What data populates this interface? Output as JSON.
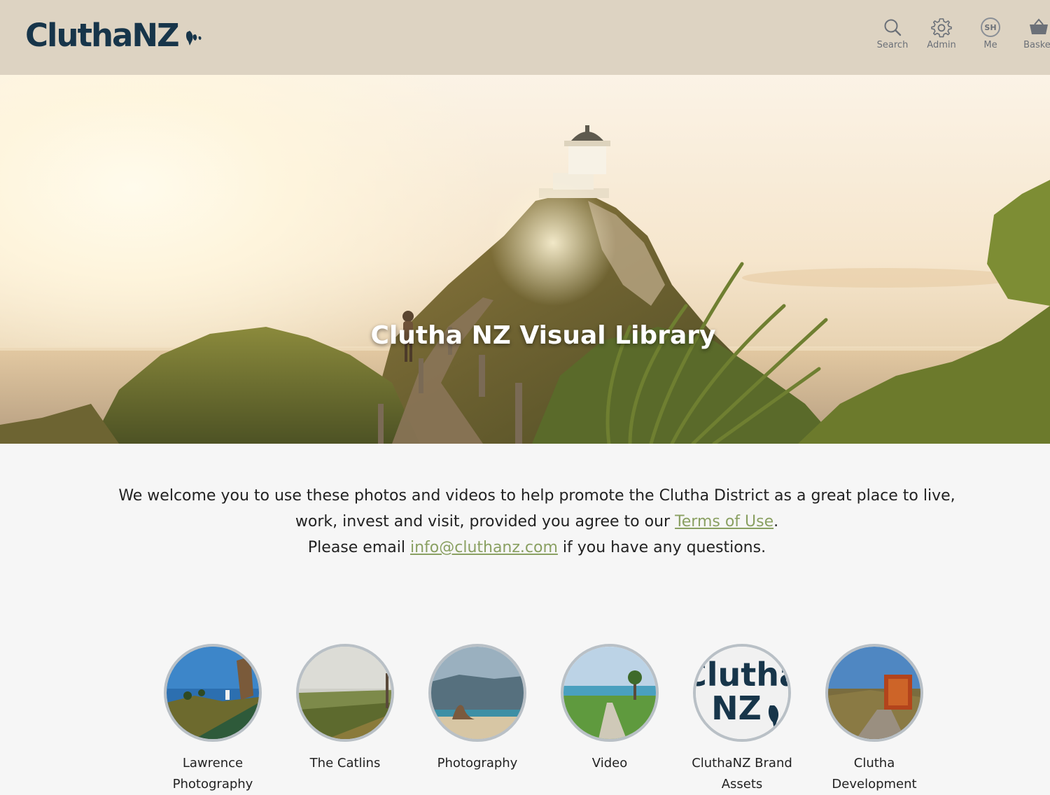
{
  "header": {
    "logo_text": "CluthaNZ",
    "nav": [
      {
        "label": "Search",
        "icon": "search-icon"
      },
      {
        "label": "Admin",
        "icon": "gear-icon"
      },
      {
        "label": "Me",
        "icon": "avatar-icon",
        "initials": "SH"
      },
      {
        "label": "Basket",
        "icon": "basket-icon"
      }
    ]
  },
  "hero": {
    "title": "Clutha NZ Visual Library"
  },
  "intro": {
    "line1": "We welcome you to use these photos and videos to help promote the Clutha District as a great place to live, work, invest and visit, provided you agree to our ",
    "terms_link": "Terms of Use",
    "line1_end": ".",
    "line2_start": "Please email ",
    "email_link": "info@cluthanz.com",
    "line2_end": " if you have any questions."
  },
  "collections": [
    {
      "label": "Lawrence Photography"
    },
    {
      "label": "The Catlins"
    },
    {
      "label": "Photography"
    },
    {
      "label": "Video"
    },
    {
      "label": "CluthaNZ Brand Assets",
      "thumb_text_1": "Clutha",
      "thumb_text_2": "NZ"
    },
    {
      "label": "Clutha Development"
    }
  ],
  "colors": {
    "header_bg": "#ddd3c2",
    "logo": "#17354a",
    "link": "#8aa062",
    "page_bg": "#f6f6f6"
  }
}
